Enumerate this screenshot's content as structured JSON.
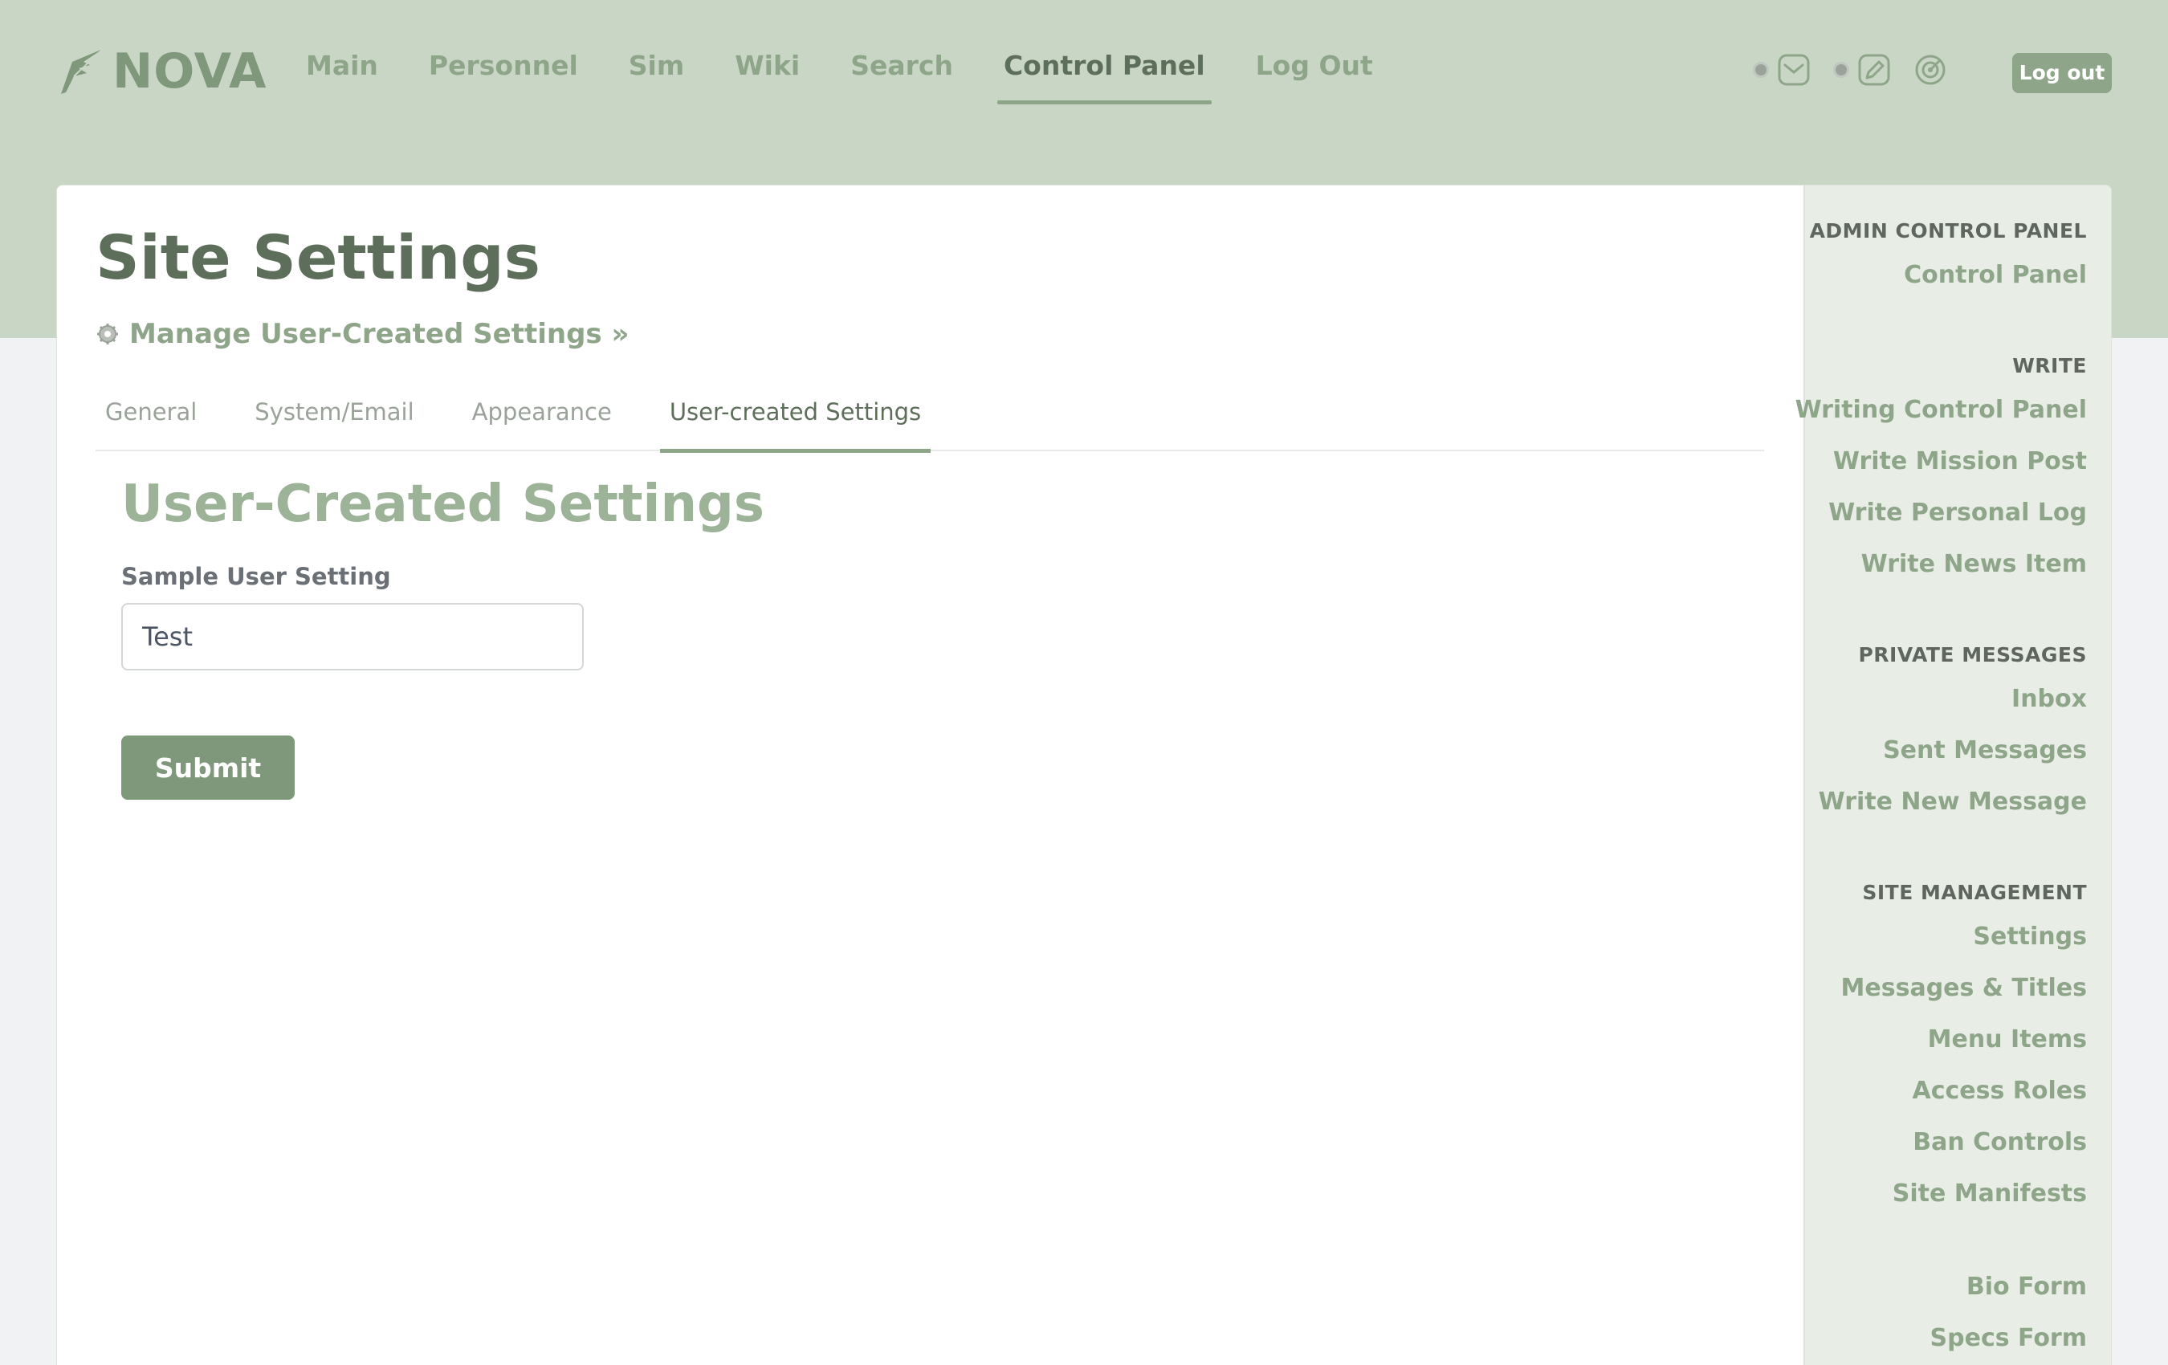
{
  "brand": {
    "name": "NOVA"
  },
  "nav": {
    "items": [
      {
        "label": "Main"
      },
      {
        "label": "Personnel"
      },
      {
        "label": "Sim"
      },
      {
        "label": "Wiki"
      },
      {
        "label": "Search"
      },
      {
        "label": "Control Panel",
        "active": true
      },
      {
        "label": "Log Out"
      }
    ],
    "logout_button": "Log out"
  },
  "page": {
    "title": "Site Settings",
    "manage_link": "Manage User-Created Settings »"
  },
  "tabs": [
    {
      "label": "General"
    },
    {
      "label": "System/Email"
    },
    {
      "label": "Appearance"
    },
    {
      "label": "User-created Settings",
      "active": true
    }
  ],
  "form": {
    "section_title": "User-Created Settings",
    "field_label": "Sample User Setting",
    "field_value": "Test",
    "submit_label": "Submit"
  },
  "sidebar": {
    "groups": [
      {
        "heading": "ADMIN CONTROL PANEL",
        "items": [
          "Control Panel"
        ]
      },
      {
        "heading": "WRITE",
        "items": [
          "Writing Control Panel",
          "Write Mission Post",
          "Write Personal Log",
          "Write News Item"
        ]
      },
      {
        "heading": "PRIVATE MESSAGES",
        "items": [
          "Inbox",
          "Sent Messages",
          "Write New Message"
        ]
      },
      {
        "heading": "SITE MANAGEMENT",
        "items": [
          "Settings",
          "Messages & Titles",
          "Menu Items",
          "Access Roles",
          "Ban Controls",
          "Site Manifests"
        ]
      },
      {
        "heading": "",
        "items": [
          "Bio Form",
          "Specs Form"
        ]
      }
    ]
  },
  "colors": {
    "header_bg": "#c9d6c5",
    "accent": "#8ea58a",
    "button": "#7f977b",
    "sidebar_bg": "#e8eee6"
  },
  "icons": {
    "logo": "quill-logo-icon",
    "messages": "envelope-icon",
    "write": "pen-icon",
    "radar": "radar-icon",
    "manage": "cog-icon"
  }
}
